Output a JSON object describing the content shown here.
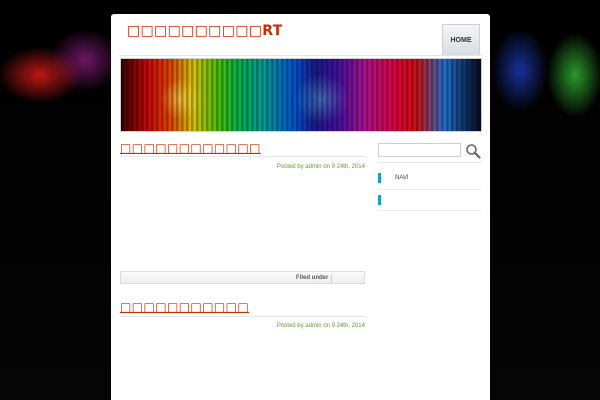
{
  "site": {
    "title": "□□□□□□□□□□RT",
    "nav": {
      "home_label": "HOME"
    }
  },
  "posts": [
    {
      "title": "□□□□□□□□□□□□",
      "meta": "Posted by admin on 9  24th, 2014",
      "filed_label": "Filed under"
    },
    {
      "title": "□□□□□□□□□□□",
      "meta": "Posted by admin on 9  24th, 2014"
    }
  ],
  "sidebar": {
    "search": {
      "value": "",
      "placeholder": ""
    },
    "widgets": [
      {
        "label": "NAVI"
      },
      {
        "label": ""
      }
    ]
  },
  "colors": {
    "accent_red": "#cc2a00",
    "meta_green": "#5aa02c",
    "widget_blue": "#1aa0c8"
  }
}
